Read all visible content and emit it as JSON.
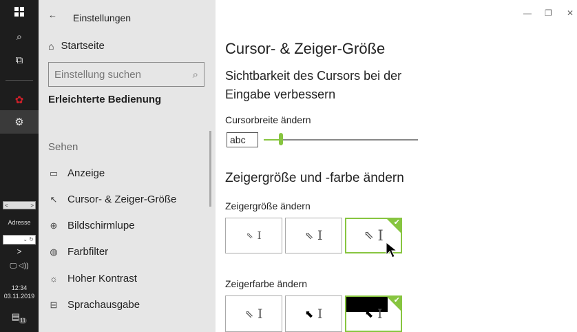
{
  "taskbar": {
    "scroll_left": "<",
    "scroll_right": ">",
    "address_label": "Adresse",
    "address_ctrl": "⌄ ↻",
    "chevron": ">",
    "tray_icons": "🖵 ◁))",
    "time": "12:34",
    "date": "03.11.2019",
    "notifications": "11"
  },
  "sidebar": {
    "back": "←",
    "title": "Einstellungen",
    "home": "Startseite",
    "search_placeholder": "Einstellung suchen",
    "category": "Erleichterte Bedienung",
    "group": "Sehen",
    "items": [
      {
        "label": "Anzeige",
        "icon": "monitor-icon"
      },
      {
        "label": "Cursor- & Zeiger-Größe",
        "icon": "cursor-icon"
      },
      {
        "label": "Bildschirmlupe",
        "icon": "magnifier-icon"
      },
      {
        "label": "Farbfilter",
        "icon": "palette-icon"
      },
      {
        "label": "Hoher Kontrast",
        "icon": "sun-icon"
      },
      {
        "label": "Sprachausgabe",
        "icon": "narrator-icon"
      }
    ]
  },
  "window": {
    "minimize": "—",
    "restore": "❐",
    "close": "✕"
  },
  "main": {
    "title": "Cursor- & Zeiger-Größe",
    "subtitle": "Sichtbarkeit des Cursors bei der Eingabe verbessern",
    "cursor_width_label": "Cursorbreite ändern",
    "cursor_preview": "abc",
    "cursor_width_level": 0.11,
    "pointer_heading": "Zeigergröße und -farbe ändern",
    "size_label": "Zeigergröße ändern",
    "color_label": "Zeigerfarbe ändern",
    "selected_size_index": 2,
    "selected_color_index": 2,
    "accent_color": "#87c540"
  }
}
